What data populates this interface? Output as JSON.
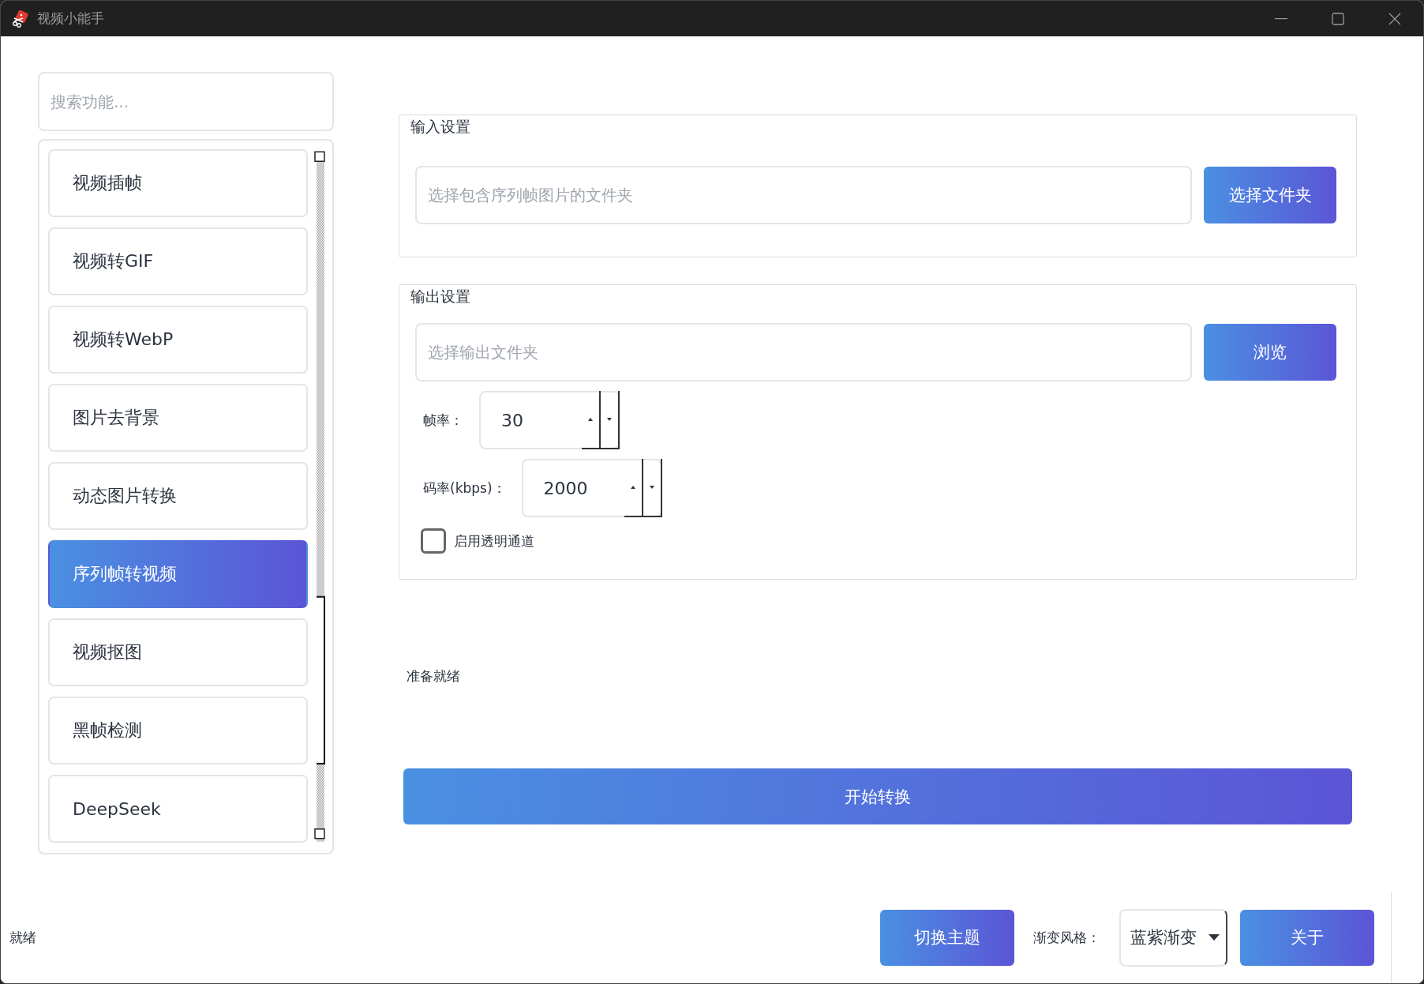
{
  "window": {
    "title": "视频小能手"
  },
  "sidebar": {
    "search": {
      "placeholder": "搜索功能..."
    },
    "items": [
      {
        "label": "视频插帧",
        "selected": false
      },
      {
        "label": "视频转GIF",
        "selected": false
      },
      {
        "label": "视频转WebP",
        "selected": false
      },
      {
        "label": "图片去背景",
        "selected": false
      },
      {
        "label": "动态图片转换",
        "selected": false
      },
      {
        "label": "序列帧转视频",
        "selected": true
      },
      {
        "label": "视频抠图",
        "selected": false
      },
      {
        "label": "黑帧检测",
        "selected": false
      },
      {
        "label": "DeepSeek",
        "selected": false
      }
    ]
  },
  "input_group": {
    "title": "输入设置",
    "folder_field": {
      "placeholder": "选择包含序列帧图片的文件夹"
    },
    "button": "选择文件夹"
  },
  "output_group": {
    "title": "输出设置",
    "folder_field": {
      "placeholder": "选择输出文件夹"
    },
    "button": "浏览",
    "spinboxes": [
      {
        "label": "帧率：",
        "value": "30"
      },
      {
        "label": "码率(kbps)：",
        "value": "2000"
      }
    ],
    "checkbox": {
      "label": "启用透明通道",
      "checked": false
    }
  },
  "progress_status": "准备就绪",
  "start_button": "开始转换",
  "status_bar": {
    "text": "就绪",
    "theme_button": "切换主题",
    "style_label": "渐变风格：",
    "style_combo": "蓝紫渐变",
    "about_button": "关于"
  }
}
